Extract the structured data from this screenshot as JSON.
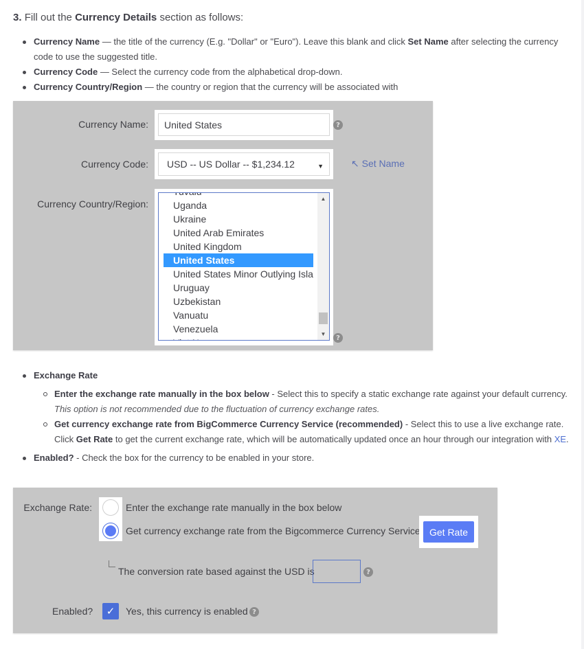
{
  "step": {
    "number": "3.",
    "text_before": "Fill out the",
    "bold": "Currency Details",
    "text_after": "section as follows:"
  },
  "field_descriptions": [
    {
      "term": "Currency Name",
      "desc_before": " — the title of the currency (E.g. \"Dollar\" or \"Euro\"). Leave this blank and click ",
      "bold_mid": "Set Name",
      "desc_after": " after selecting the currency code to use the suggested title."
    },
    {
      "term": "Currency Code",
      "desc": " — Select the currency code from the alphabetical drop-down."
    },
    {
      "term": "Currency Country/Region",
      "desc": " — the country or region that the currency will be associated with"
    }
  ],
  "form1": {
    "currency_name_label": "Currency Name:",
    "currency_name_value": "United States",
    "currency_code_label": "Currency Code:",
    "currency_code_value": "USD -- US Dollar -- $1,234.12",
    "set_name_label": "↖ Set Name",
    "country_label": "Currency Country/Region:",
    "country_options": [
      "Tuvalu",
      "Uganda",
      "Ukraine",
      "United Arab Emirates",
      "United Kingdom",
      "United States",
      "United States Minor Outlying Islands",
      "Uruguay",
      "Uzbekistan",
      "Vanuatu",
      "Venezuela",
      "Viet Nam"
    ],
    "country_selected": "United States",
    "help_glyph": "?"
  },
  "exchange_section": {
    "title": "Exchange Rate",
    "options": [
      {
        "bold": "Enter the exchange rate manually in the box below",
        "desc": " - Select this to specify a static exchange rate against your default currency.",
        "note": "This option is not recommended due to the fluctuation of currency exchange rates."
      },
      {
        "bold": "Get currency exchange rate from BigCommerce Currency Service (recommended)",
        "desc": " - Select this to use a live exchange rate. Click ",
        "bold2": "Get Rate",
        "desc2": " to get the current exchange rate, which will be automatically updated once an hour through our integration with ",
        "link": "XE",
        "end": "."
      }
    ],
    "enabled_title": "Enabled?",
    "enabled_desc": " - Check the box for the currency to be enabled in your store."
  },
  "form2": {
    "exchange_rate_label": "Exchange Rate:",
    "radio_manual_label": "Enter the exchange rate manually in the box below",
    "radio_manual_checked": false,
    "radio_service_label": "Get currency exchange rate from the Bigcommerce Currency Service",
    "radio_service_checked": true,
    "get_rate_button": "Get Rate",
    "conversion_label": "The conversion rate based against the USD is",
    "conversion_value": "",
    "enabled_label": "Enabled?",
    "enabled_checked": true,
    "enabled_text": "Yes, this currency is enabled",
    "check_glyph": "✓",
    "help_glyph": "?"
  },
  "colors": {
    "panel_bg": "#c6c6c6",
    "accent_blue": "#5a7cf5",
    "selection_blue": "#3399ff",
    "link_blue": "#4d6fd1"
  }
}
